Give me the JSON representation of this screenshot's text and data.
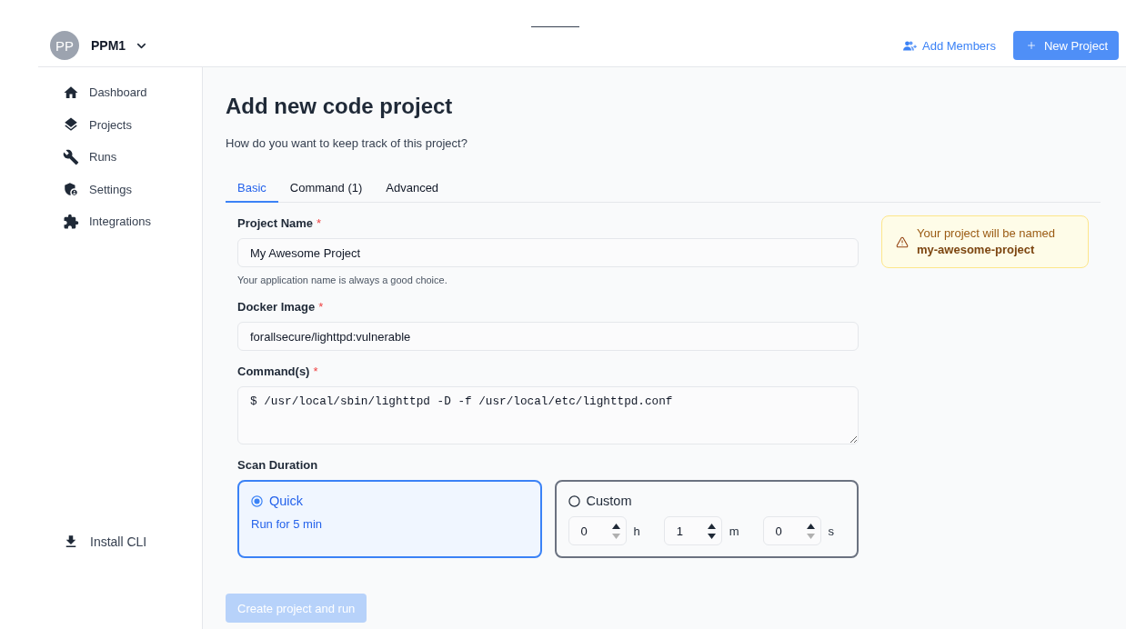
{
  "header": {
    "avatar_initials": "PP",
    "workspace_name": "PPM1",
    "add_members_label": "Add Members",
    "new_project_label": "New Project"
  },
  "sidebar": {
    "items": [
      {
        "label": "Dashboard"
      },
      {
        "label": "Projects"
      },
      {
        "label": "Runs"
      },
      {
        "label": "Settings"
      },
      {
        "label": "Integrations"
      }
    ],
    "footer_items": [
      {
        "label": "Install CLI"
      }
    ]
  },
  "page": {
    "title": "Add new code project",
    "subtitle": "How do you want to keep track of this project?"
  },
  "tabs": [
    {
      "label": "Basic",
      "selected": true
    },
    {
      "label": "Command (1)",
      "selected": false
    },
    {
      "label": "Advanced",
      "selected": false
    }
  ],
  "form": {
    "fields": [
      {
        "kind": "text",
        "label": "Project Name",
        "required_mark": "*",
        "value": "My Awesome Project",
        "help": "Your application name is always a good choice."
      },
      {
        "kind": "text",
        "label": "Docker Image",
        "required_mark": "*",
        "value": "forallsecure/lighttpd:vulnerable"
      },
      {
        "kind": "textarea",
        "label": "Command(s)",
        "required_mark": "*",
        "value": "$ /usr/local/sbin/lighttpd -D -f /usr/local/etc/lighttpd.conf"
      }
    ],
    "scan_duration": {
      "label": "Scan Duration",
      "options": [
        {
          "kind": "preset",
          "label": "Quick",
          "selected": true,
          "description": "Run for 5 min"
        },
        {
          "kind": "custom",
          "label": "Custom",
          "selected": false,
          "fields": [
            {
              "value": "0",
              "unit": "h",
              "decrement_disabled": true
            },
            {
              "value": "1",
              "unit": "m",
              "decrement_disabled": false
            },
            {
              "value": "0",
              "unit": "s",
              "decrement_disabled": true
            }
          ]
        }
      ]
    },
    "submit": {
      "label": "Create project and run",
      "disabled": true
    }
  },
  "notice": {
    "text": "Your project will be named **my-awesome-project**"
  }
}
